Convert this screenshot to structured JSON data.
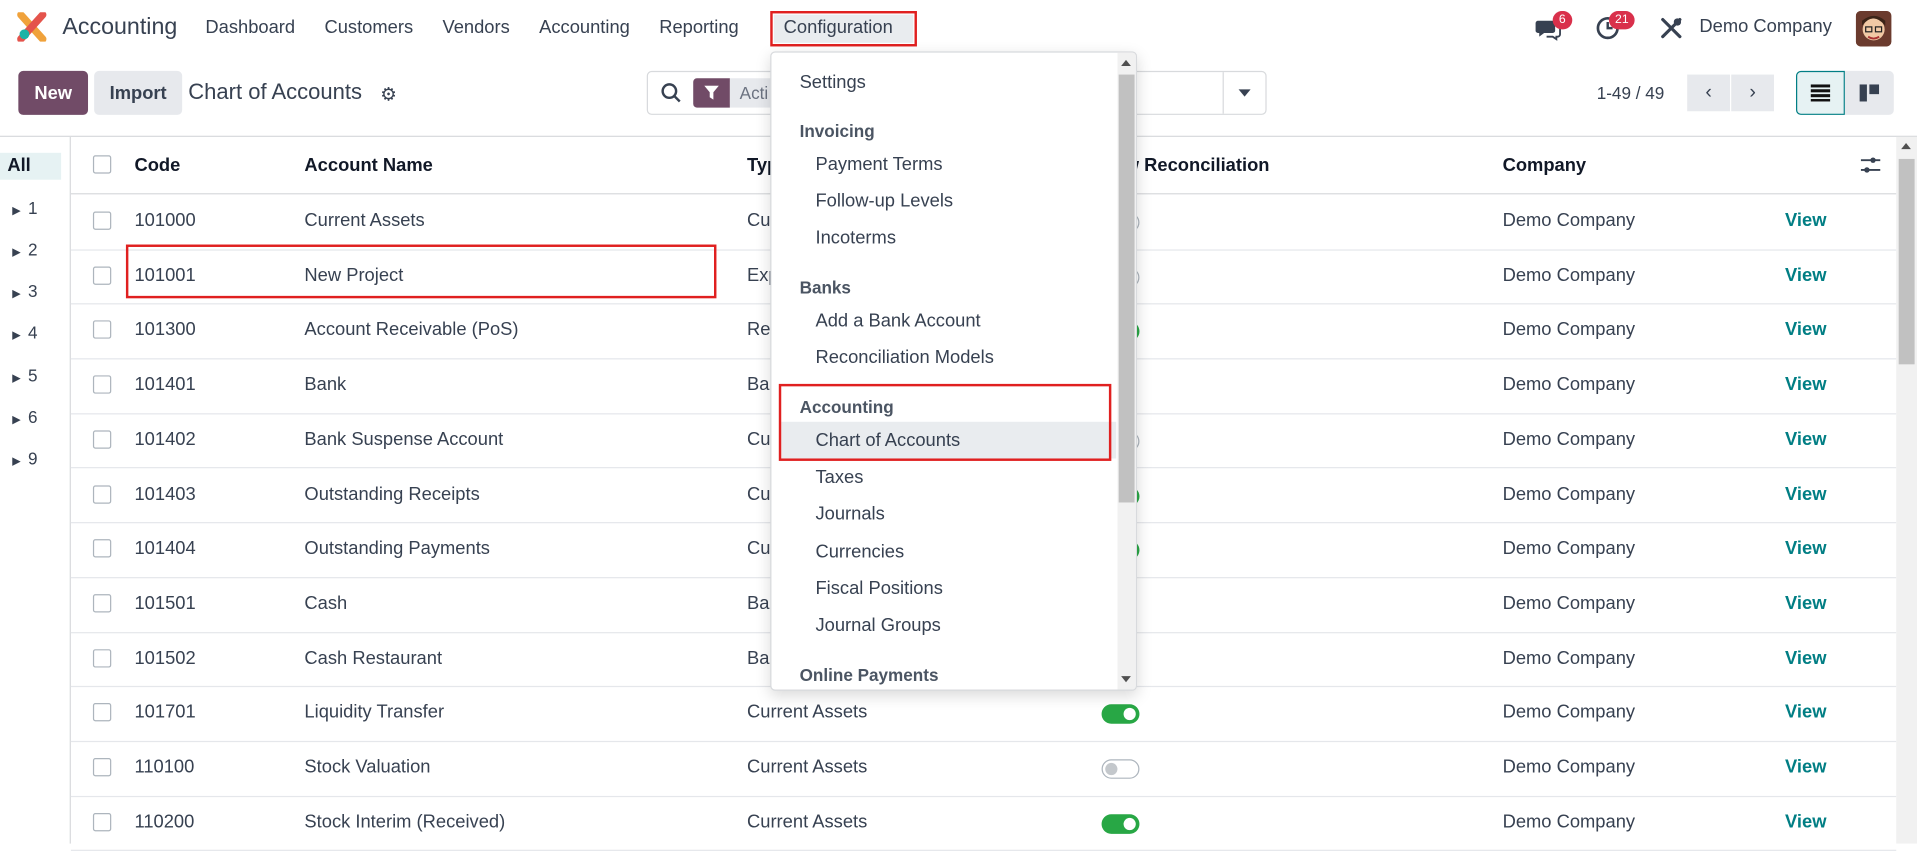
{
  "navbar": {
    "app_name": "Accounting",
    "menu": [
      "Dashboard",
      "Customers",
      "Vendors",
      "Accounting",
      "Reporting",
      "Configuration"
    ],
    "messages_badge": "6",
    "activities_badge": "21",
    "company": "Demo Company"
  },
  "control_panel": {
    "new_label": "New",
    "import_label": "Import",
    "breadcrumb": "Chart of Accounts",
    "search_facet": "Acti",
    "pager": "1-49 / 49"
  },
  "side_panel": {
    "all_label": "All",
    "groups": [
      "1",
      "2",
      "3",
      "4",
      "5",
      "6",
      "9"
    ]
  },
  "table": {
    "headers": {
      "code": "Code",
      "name": "Account Name",
      "type": "Typ",
      "reconcile": "w Reconciliation",
      "company": "Company"
    },
    "view_label": "View",
    "rows": [
      {
        "code": "101000",
        "name": "Current Assets",
        "type": "Cu",
        "reconcile": "off",
        "company": "Demo Company"
      },
      {
        "code": "101001",
        "name": "New Project",
        "type": "Exp",
        "reconcile": "off",
        "company": "Demo Company"
      },
      {
        "code": "101300",
        "name": "Account Receivable (PoS)",
        "type": "Rec",
        "reconcile": "on",
        "company": "Demo Company"
      },
      {
        "code": "101401",
        "name": "Bank",
        "type": "Ban",
        "reconcile": "none",
        "company": "Demo Company"
      },
      {
        "code": "101402",
        "name": "Bank Suspense Account",
        "type": "Cu",
        "reconcile": "off",
        "company": "Demo Company"
      },
      {
        "code": "101403",
        "name": "Outstanding Receipts",
        "type": "Cu",
        "reconcile": "on",
        "company": "Demo Company"
      },
      {
        "code": "101404",
        "name": "Outstanding Payments",
        "type": "Cu",
        "reconcile": "on",
        "company": "Demo Company"
      },
      {
        "code": "101501",
        "name": "Cash",
        "type": "Ban",
        "reconcile": "none",
        "company": "Demo Company"
      },
      {
        "code": "101502",
        "name": "Cash Restaurant",
        "type": "Ban",
        "reconcile": "none",
        "company": "Demo Company"
      },
      {
        "code": "101701",
        "name": "Liquidity Transfer",
        "type": "Current Assets",
        "reconcile": "on",
        "company": "Demo Company"
      },
      {
        "code": "110100",
        "name": "Stock Valuation",
        "type": "Current Assets",
        "reconcile": "off",
        "company": "Demo Company"
      },
      {
        "code": "110200",
        "name": "Stock Interim (Received)",
        "type": "Current Assets",
        "reconcile": "on",
        "company": "Demo Company"
      }
    ]
  },
  "dropdown": {
    "settings": "Settings",
    "invoicing_header": "Invoicing",
    "invoicing": [
      "Payment Terms",
      "Follow-up Levels",
      "Incoterms"
    ],
    "banks_header": "Banks",
    "banks": [
      "Add a Bank Account",
      "Reconciliation Models"
    ],
    "accounting_header": "Accounting",
    "accounting": [
      "Chart of Accounts",
      "Taxes",
      "Journals",
      "Currencies",
      "Fiscal Positions",
      "Journal Groups"
    ],
    "online_payments_header": "Online Payments"
  },
  "colors": {
    "brand": "#714b67",
    "link": "#017e84",
    "highlight": "#e02020",
    "toggle_on": "#28a745"
  }
}
